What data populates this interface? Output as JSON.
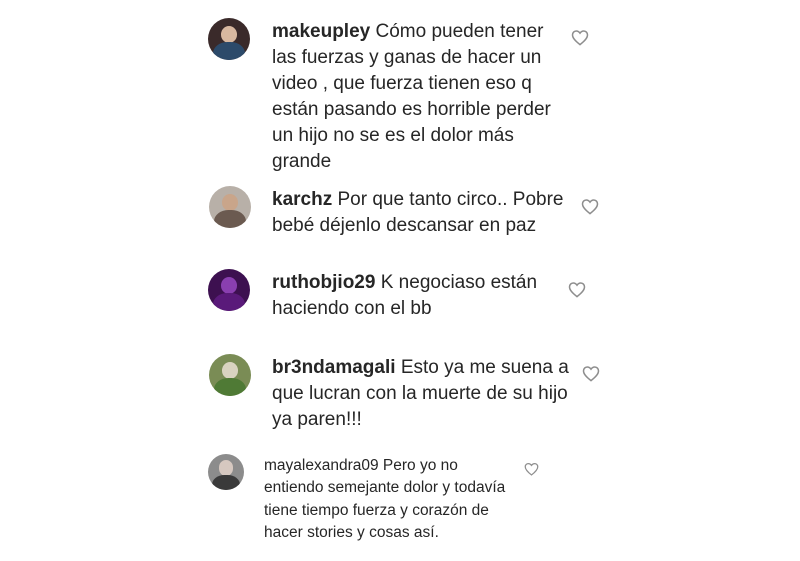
{
  "comments": [
    {
      "username": "makeupley",
      "text": "Cómo pueden tener las fuerzas y ganas de hacer un video , que fuerza tienen eso q están pasando es horrible perder un hijo no se es el dolor más grande",
      "avatar_color": "#3a2a2a",
      "like_icon": "heart-outline-icon"
    },
    {
      "username": "karchz",
      "text": "Por que tanto circo.. Pobre bebé déjenlo descansar en paz",
      "avatar_color": "#b8b0a8",
      "like_icon": "heart-outline-icon"
    },
    {
      "username": "ruthobjio29",
      "text": "K negociaso están haciendo con el bb",
      "avatar_color": "#3d1050",
      "like_icon": "heart-outline-icon"
    },
    {
      "username": "br3ndamagali",
      "text": "Esto ya me suena a que lucran con la muerte de su hijo ya paren!!!",
      "avatar_color": "#7a8c55",
      "like_icon": "heart-outline-icon"
    },
    {
      "username": "mayalexandra09",
      "text": "Pero yo no entiendo semejante dolor y todavía tiene tiempo fuerza y corazón de hacer stories y cosas así.",
      "avatar_color": "#8c8c8c",
      "like_icon": "heart-outline-icon"
    }
  ]
}
